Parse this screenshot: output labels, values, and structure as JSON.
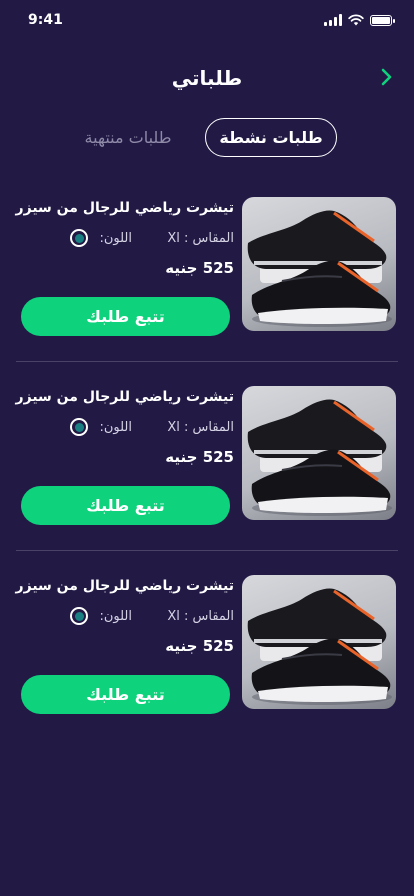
{
  "status_bar": {
    "time": "9:41"
  },
  "header": {
    "title": "طلباتي"
  },
  "tabs": [
    {
      "label": "طلبات نشطة",
      "active": true
    },
    {
      "label": "طلبات منتهية",
      "active": false
    }
  ],
  "orders": [
    {
      "name": "تيشرت رياضي للرجال من سيزر",
      "size": "المقاس : Xl",
      "color_label": "اللون:",
      "price": "525 جنيه",
      "track_label": "تتبع طلبك",
      "image": "sneakers-photo"
    },
    {
      "name": "تيشرت رياضي للرجال من سيزر",
      "size": "المقاس : Xl",
      "color_label": "اللون:",
      "price": "525 جنيه",
      "track_label": "تتبع طلبك",
      "image": "sneakers-photo"
    },
    {
      "name": "تيشرت رياضي للرجال من سيزر",
      "size": "المقاس : Xl",
      "color_label": "اللون:",
      "price": "525 جنيه",
      "track_label": "تتبع طلبك",
      "image": "sneakers-photo"
    }
  ],
  "colors": {
    "background": "#221a45",
    "accent": "#0fd27d",
    "selected_color_swatch": "#1a7f82",
    "muted_text": "#8f8aa8"
  }
}
